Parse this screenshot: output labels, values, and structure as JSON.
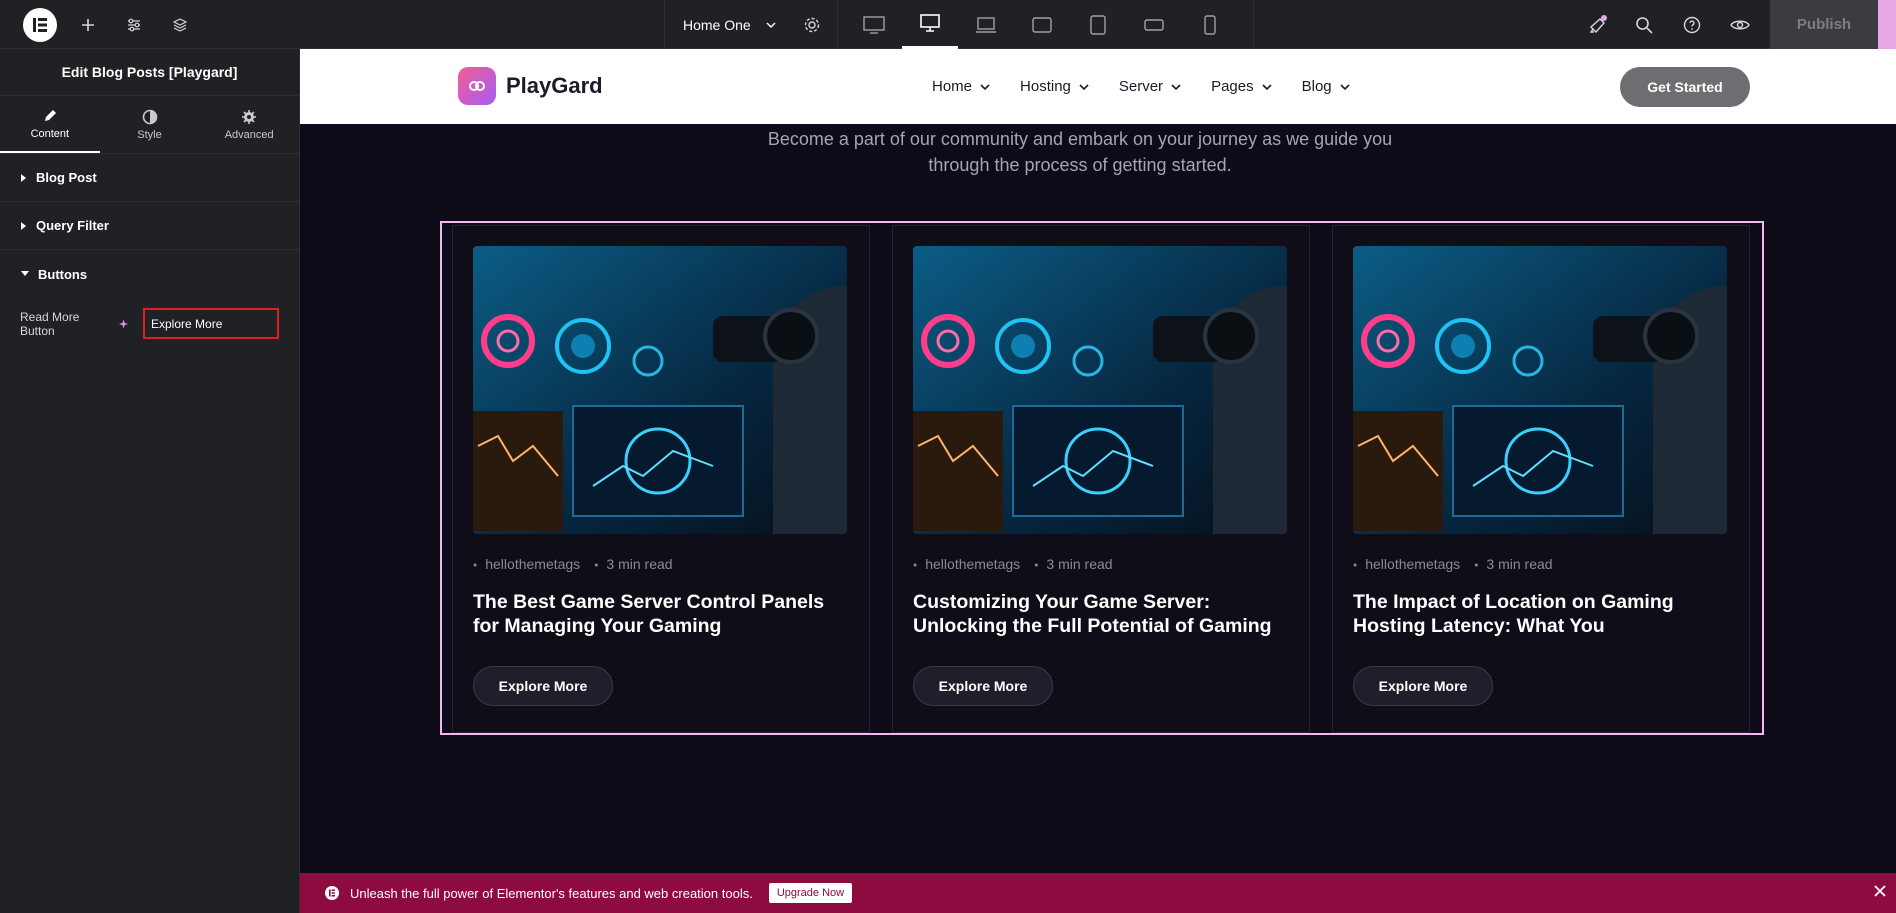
{
  "topbar": {
    "page_name": "Home One",
    "publish_label": "Publish"
  },
  "panel": {
    "title": "Edit Blog Posts [Playgard]",
    "tabs": [
      {
        "label": "Content",
        "icon": "pencil-icon"
      },
      {
        "label": "Style",
        "icon": "half-circle-icon"
      },
      {
        "label": "Advanced",
        "icon": "gear-icon"
      }
    ],
    "sections": {
      "blog_post": "Blog Post",
      "query_filter": "Query Filter",
      "buttons": "Buttons"
    },
    "read_more_label": "Read More Button",
    "read_more_value": "Explore More"
  },
  "site": {
    "brand": "PlayGard",
    "nav": [
      "Home",
      "Hosting",
      "Server",
      "Pages",
      "Blog"
    ],
    "cta": "Get Started",
    "intro": "Become a part of our community and embark on your journey as we guide you through the process of getting started."
  },
  "posts": [
    {
      "tag": "hellothemetags",
      "read": "3 min read",
      "title": "The Best Game Server Control Panels for Managing Your Gaming",
      "button": "Explore More"
    },
    {
      "tag": "hellothemetags",
      "read": "3 min read",
      "title": "Customizing Your Game Server: Unlocking the Full Potential of Gaming",
      "button": "Explore More"
    },
    {
      "tag": "hellothemetags",
      "read": "3 min read",
      "title": "The Impact of Location on Gaming Hosting Latency: What You",
      "button": "Explore More"
    }
  ],
  "promo": {
    "text": "Unleash the full power of Elementor's features and web creation tools.",
    "button": "Upgrade Now"
  },
  "colors": {
    "accent_pink": "#f2b6f0",
    "promo_bg": "#8d0b3e",
    "highlight_border": "#e11d1d"
  }
}
